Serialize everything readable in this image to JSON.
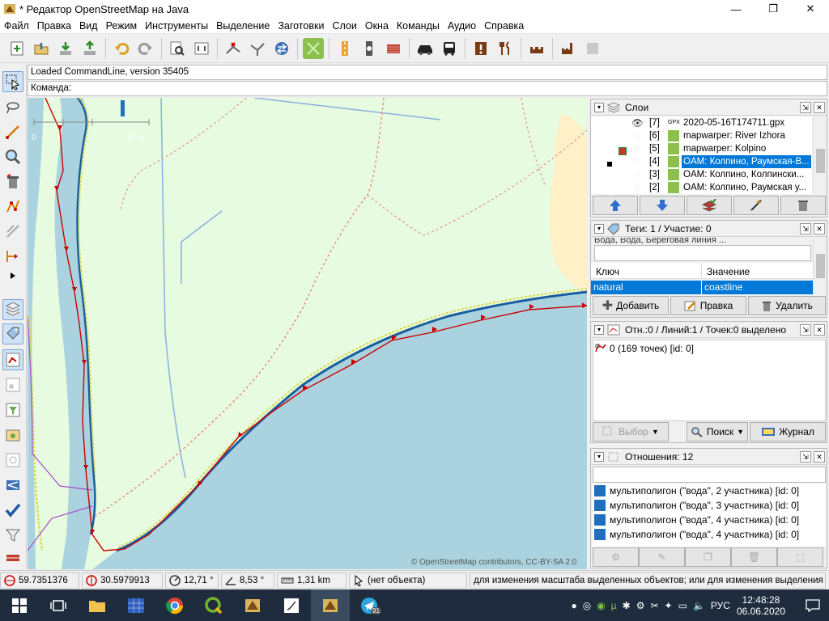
{
  "window": {
    "title": "* Редактор OpenStreetMap на Java",
    "minimize": "—",
    "restore": "❐",
    "close": "✕"
  },
  "menu": [
    "Файл",
    "Правка",
    "Вид",
    "Режим",
    "Инструменты",
    "Выделение",
    "Заготовки",
    "Слои",
    "Окна",
    "Команды",
    "Аудио",
    "Справка"
  ],
  "command": {
    "info": "Loaded CommandLine, version 35405",
    "label": "Команда:"
  },
  "map": {
    "scale_start": "0",
    "scale_end": "40 m",
    "attribution": "© OpenStreetMap contributors, CC-BY-SA 2.0"
  },
  "layers_panel": {
    "title": "Слои",
    "layers": [
      {
        "index": "[7]",
        "name": "2020-05-16T174711.gpx",
        "type": "GPX",
        "visible": true,
        "selected": false
      },
      {
        "index": "[6]",
        "name": "mapwarper: River Izhora",
        "type": "",
        "visible": false,
        "selected": false
      },
      {
        "index": "[5]",
        "name": "mapwarper: Kolpino",
        "type": "",
        "visible": false,
        "selected": false
      },
      {
        "index": "[4]",
        "name": "OAM: Колпино, Раумская-В...",
        "type": "",
        "visible": false,
        "selected": true
      },
      {
        "index": "[3]",
        "name": "OAM: Колпино, Колпински...",
        "type": "",
        "visible": false,
        "selected": false
      },
      {
        "index": "[2]",
        "name": "OAM: Колпино, Раумская у...",
        "type": "",
        "visible": false,
        "selected": false
      }
    ]
  },
  "tags_panel": {
    "title": "Теги: 1 / Участие: 0",
    "preset_line": "Вода, Вода, Береговая линия ...",
    "col_key": "Ключ",
    "col_value": "Значение",
    "rows": [
      {
        "key": "natural",
        "value": "coastline"
      }
    ],
    "add": "Добавить",
    "edit": "Правка",
    "delete": "Удалить"
  },
  "selection_panel": {
    "title": "Отн.:0 / Линий:1 / Точек:0 выделено",
    "item": "0 (169 точек) [id: 0]",
    "select": "Выбор",
    "search": "Поиск",
    "history": "Журнал"
  },
  "relations_panel": {
    "title": "Отношения: 12",
    "items": [
      "мультиполигон (\"вода\", 2 участника) [id: 0]",
      "мультиполигон (\"вода\", 3 участника) [id: 0]",
      "мультиполигон (\"вода\", 4 участника) [id: 0]",
      "мультиполигон (\"вода\", 4 участника) [id: 0]"
    ]
  },
  "status": {
    "lat": "59.7351376",
    "lon": "30.5979913",
    "heading": "12,71 °",
    "angle": "8,53 °",
    "distance": "1,31 km",
    "object": "(нет объекта)",
    "hint": "для изменения масштаба выделенных объектов; или для изменения выделения"
  },
  "taskbar": {
    "lang": "РУС",
    "time": "12:48:28",
    "date": "06.06.2020",
    "badge": "91"
  },
  "colors": {
    "water": "#aad3df",
    "land": "#e7fbe0",
    "sand": "#fff0c8",
    "track": "#cc0000",
    "accent": "#0078d7"
  }
}
